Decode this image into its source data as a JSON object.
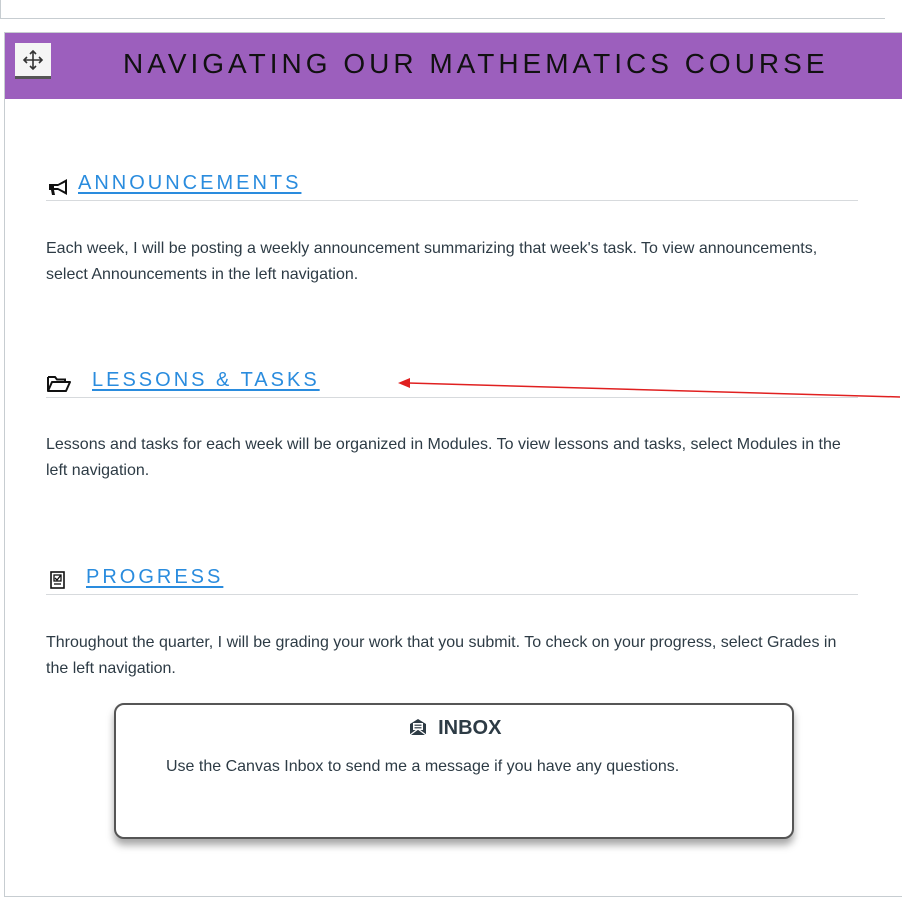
{
  "banner": {
    "title": "NAVIGATING OUR MATHEMATICS COURSE",
    "background": "#9c5fbd",
    "handle_icon": "move-icon"
  },
  "sections": [
    {
      "icon": "megaphone-icon",
      "title": "ANNOUNCEMENTS",
      "body": "Each week, I will be posting a weekly announcement summarizing that week's task. To view announcements, select Announcements in the left navigation."
    },
    {
      "icon": "folder-open-icon",
      "title": "LESSONS & TASKS",
      "body": "Lessons and tasks for each week will be organized in Modules.  To view lessons and tasks, select Modules in the left navigation."
    },
    {
      "icon": "checklist-icon",
      "title": "PROGRESS",
      "body": "Throughout the quarter, I will be grading your work that you submit.  To check on your progress, select Grades in the left navigation."
    }
  ],
  "inbox": {
    "icon": "inbox-icon",
    "title": "INBOX",
    "body": "Use the Canvas Inbox to send me a message if you have any questions."
  },
  "colors": {
    "link": "#2a8cde",
    "annotation_arrow": "#e02020",
    "text": "#2d3b45"
  }
}
